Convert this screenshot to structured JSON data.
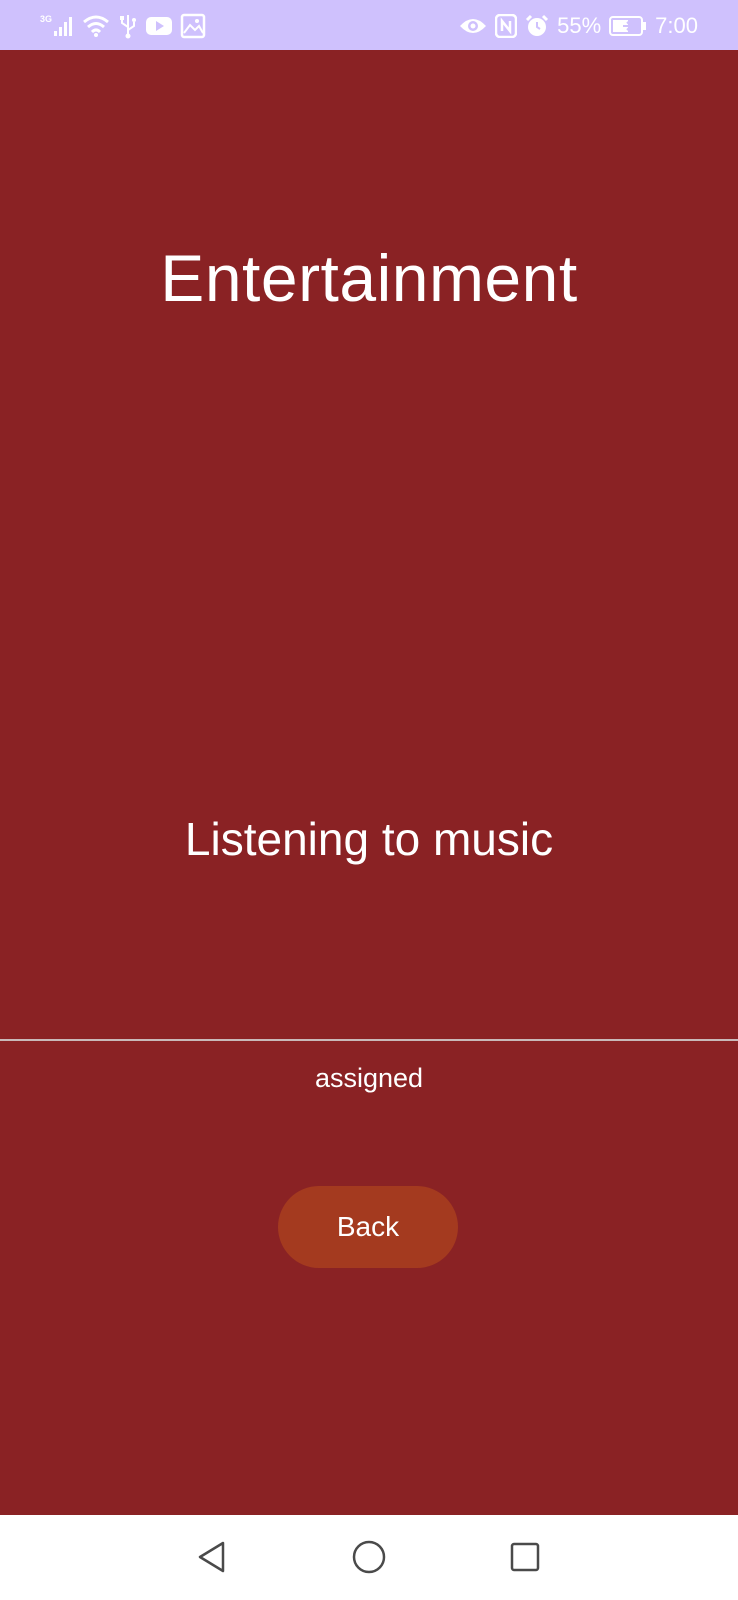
{
  "status_bar": {
    "network": "3G",
    "battery_percent": "55%",
    "time": "7:00",
    "icons": [
      "signal-icon",
      "wifi-icon",
      "usb-icon",
      "youtube-icon",
      "gallery-icon",
      "eye-icon",
      "nfc-icon",
      "alarm-icon",
      "battery-icon"
    ]
  },
  "main": {
    "title": "Entertainment",
    "activity": "Listening to music",
    "status": "assigned",
    "back_label": "Back"
  },
  "nav_bar": {
    "icons": [
      "back-triangle-icon",
      "home-circle-icon",
      "recents-square-icon"
    ]
  },
  "colors": {
    "background": "#8a2224",
    "status_bar": "#cfc1fd",
    "button": "#a43a1f",
    "nav_bar": "#ffffff"
  }
}
